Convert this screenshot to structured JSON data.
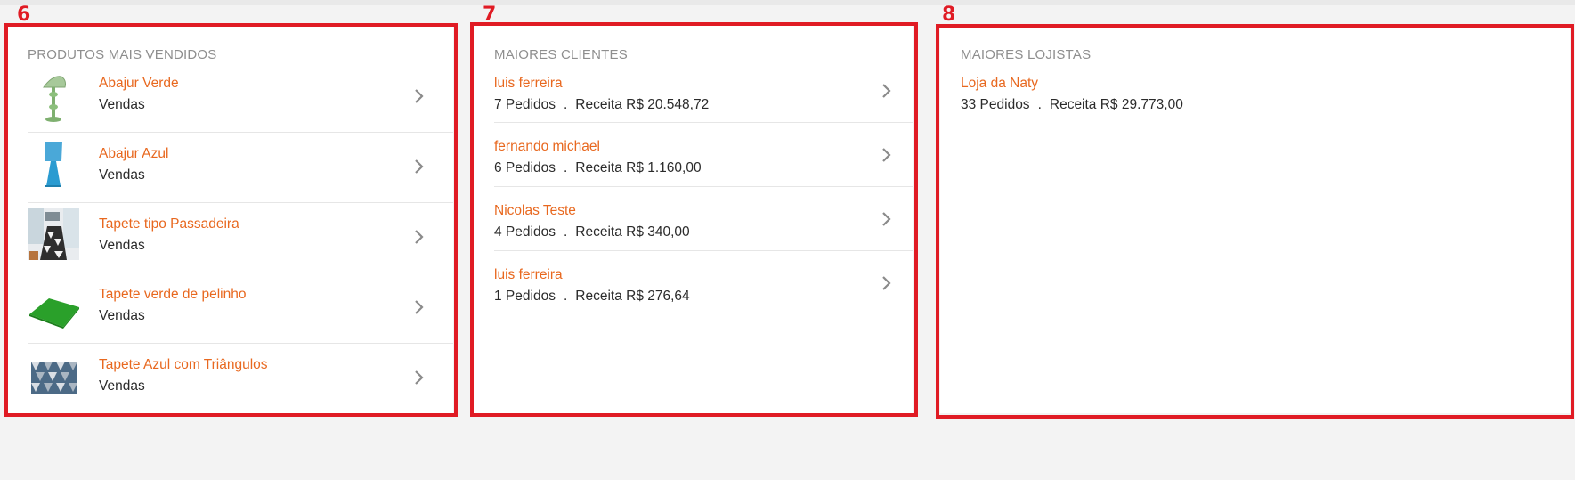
{
  "annotations": {
    "a": "6",
    "b": "7",
    "c": "8"
  },
  "products": {
    "title": "PRODUTOS MAIS VENDIDOS",
    "items": [
      {
        "name": "Abajur Verde",
        "sub": "Vendas",
        "image": "green-lamp-icon"
      },
      {
        "name": "Abajur Azul",
        "sub": "Vendas",
        "image": "blue-lamp-icon"
      },
      {
        "name": "Tapete tipo Passadeira",
        "sub": "Vendas",
        "image": "runner-rug-photo"
      },
      {
        "name": "Tapete verde de pelinho",
        "sub": "Vendas",
        "image": "green-rug-icon"
      },
      {
        "name": "Tapete Azul com Triângulos",
        "sub": "Vendas",
        "image": "blue-triangle-rug-icon"
      }
    ]
  },
  "clients": {
    "title": "MAIORES CLIENTES",
    "items": [
      {
        "name": "luis ferreira",
        "orders": "7 Pedidos",
        "revenue": "Receita R$ 20.548,72"
      },
      {
        "name": "fernando michael",
        "orders": "6 Pedidos",
        "revenue": "Receita R$ 1.160,00"
      },
      {
        "name": "Nicolas Teste",
        "orders": "4 Pedidos",
        "revenue": "Receita R$ 340,00"
      },
      {
        "name": "luis ferreira",
        "orders": "1 Pedidos",
        "revenue": "Receita R$ 276,64"
      }
    ]
  },
  "stores": {
    "title": "MAIORES LOJISTAS",
    "items": [
      {
        "name": "Loja da Naty",
        "orders": "33 Pedidos",
        "revenue": "Receita R$ 29.773,00"
      }
    ]
  },
  "separator": ".",
  "colors": {
    "accent": "#e8681f",
    "annotation": "#e01b24",
    "chevron": "#8a8a8a"
  }
}
